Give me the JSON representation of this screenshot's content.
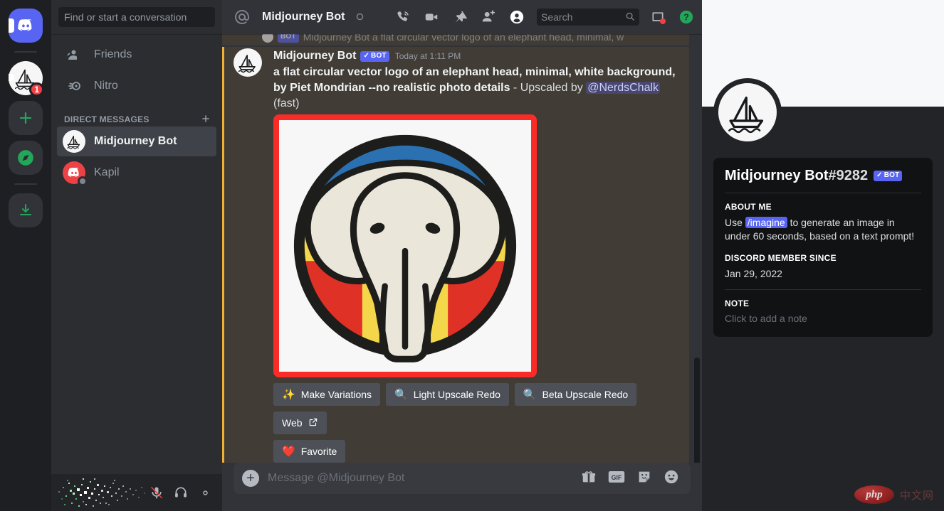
{
  "rail": {
    "items": [
      {
        "name": "home",
        "label": "Home",
        "icon": "discord-logo-icon",
        "badge": null
      },
      {
        "name": "midjourney-server",
        "label": "Midjourney",
        "icon": "sailboat-icon",
        "badge": "1"
      },
      {
        "name": "add-server",
        "label": "Add a Server",
        "icon": "plus-icon",
        "badge": null
      },
      {
        "name": "explore",
        "label": "Explore Public Servers",
        "icon": "compass-icon",
        "badge": null
      },
      {
        "name": "download",
        "label": "Download Apps",
        "icon": "download-icon",
        "badge": null
      }
    ]
  },
  "sidebar": {
    "search_placeholder": "Find or start a conversation",
    "nav": [
      {
        "label": "Friends",
        "icon": "friends-icon"
      },
      {
        "label": "Nitro",
        "icon": "nitro-icon"
      }
    ],
    "section_title": "DIRECT MESSAGES",
    "add_dm_icon": "plus-icon",
    "dms": [
      {
        "label": "Midjourney Bot",
        "avatar": "sailboat-avatar",
        "active": true,
        "status": null
      },
      {
        "label": "Kapil",
        "avatar": "discord-avatar",
        "active": false,
        "status": "offline"
      }
    ],
    "user_controls": [
      {
        "name": "mute",
        "icon": "mic-muted-icon"
      },
      {
        "name": "deafen",
        "icon": "headphones-icon"
      },
      {
        "name": "settings",
        "icon": "gear-icon"
      }
    ]
  },
  "topbar": {
    "at_icon": "at-icon",
    "title": "Midjourney Bot",
    "status_dot": "offline-circle-icon",
    "icons": [
      {
        "name": "start-voice-call",
        "icon": "phone-call-icon"
      },
      {
        "name": "start-video-call",
        "icon": "video-camera-icon"
      },
      {
        "name": "pinned-messages",
        "icon": "pin-icon"
      },
      {
        "name": "add-friends-to-dm",
        "icon": "person-add-icon"
      },
      {
        "name": "user-profile",
        "icon": "user-profile-icon"
      }
    ],
    "search_placeholder": "Search",
    "search_icon": "search-icon",
    "inbox_icon": "inbox-icon",
    "help_icon": "help-circle-icon"
  },
  "message": {
    "reply_preview": "Midjourney Bot a flat circular vector logo of an elephant head, minimal, w",
    "reply_bot_tag": "BOT",
    "author": "Midjourney Bot",
    "bot_tag": "BOT",
    "timestamp": "Today at 1:11 PM",
    "prompt": "a flat circular vector logo of an elephant head, minimal, white background, by Piet Mondrian --no realistic photo details",
    "upscaled_by_text": " - Upscaled by ",
    "mention": "@NerdsChalk",
    "fast_suffix": "(fast)",
    "attachment_alt": "Mondrian-style circular elephant head logo",
    "attachment_highlight_color": "#fb2b28",
    "buttons_row1": [
      {
        "label": "Make Variations",
        "icon": "sparkles-icon"
      },
      {
        "label": "Light Upscale Redo",
        "icon": "magnifier-icon"
      },
      {
        "label": "Beta Upscale Redo",
        "icon": "magnifier-icon"
      }
    ],
    "buttons_row2": [
      {
        "label": "Web",
        "icon": "external-link-icon"
      }
    ],
    "buttons_row3": [
      {
        "label": "Favorite",
        "icon": "heart-icon"
      }
    ]
  },
  "composer": {
    "placeholder": "Message @Midjourney Bot",
    "plus_icon": "plus-circle-icon",
    "icons": [
      {
        "name": "gift",
        "icon": "gift-icon"
      },
      {
        "name": "gif-picker",
        "icon": "gif-icon",
        "label": "GIF"
      },
      {
        "name": "sticker-picker",
        "icon": "sticker-icon"
      },
      {
        "name": "emoji-picker",
        "icon": "emoji-icon"
      }
    ]
  },
  "profile": {
    "avatar": "sailboat-avatar",
    "name": "Midjourney Bot",
    "discriminator": "#9282",
    "bot_tag": "BOT",
    "about_label": "ABOUT ME",
    "about_pre": "Use ",
    "about_code": "/imagine",
    "about_post": " to generate an image in under 60 seconds, based on a text prompt!",
    "member_since_label": "DISCORD MEMBER SINCE",
    "member_since_value": "Jan 29, 2022",
    "note_label": "NOTE",
    "note_placeholder": "Click to add a note"
  },
  "watermark": {
    "brand": "php",
    "suffix": "中文网"
  },
  "colors": {
    "accent": "#5865f2",
    "highlight_mention_bg": "#413c36",
    "highlight_border": "#f0b132",
    "attachment_border": "#fb2b28",
    "badge_red": "#f23f43",
    "green": "#23a55a"
  }
}
